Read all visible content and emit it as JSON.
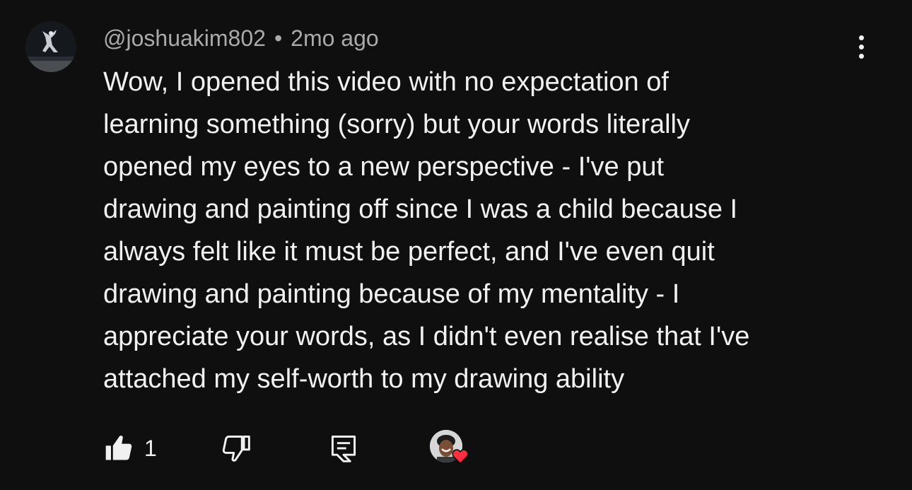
{
  "comment": {
    "author": "@joshuakim802",
    "separator": "•",
    "time": "2mo ago",
    "lines": [
      "Wow, I opened this video with no expectation of",
      "learning something (sorry) but your words literally",
      "opened my eyes to a new perspective - I've put",
      "drawing and painting off since I was a child because I",
      "always felt like it must be perfect, and I've even quit",
      "drawing and painting because of my mentality - I",
      "appreciate your words, as I didn't even realise that I've",
      "attached my self-worth to my drawing ability"
    ],
    "like_count": "1"
  },
  "icons": {
    "avatar": "user-avatar",
    "more": "more-vertical-icon",
    "like": "thumbs-up-filled-icon",
    "dislike": "thumbs-down-outline-icon",
    "reply": "reply-comment-icon",
    "creator_heart": "creator-heart-icon"
  },
  "colors": {
    "background": "#0f0f0f",
    "text": "#f1f1f1",
    "meta": "#aaaaaa",
    "heart": "#ff2d3d"
  }
}
